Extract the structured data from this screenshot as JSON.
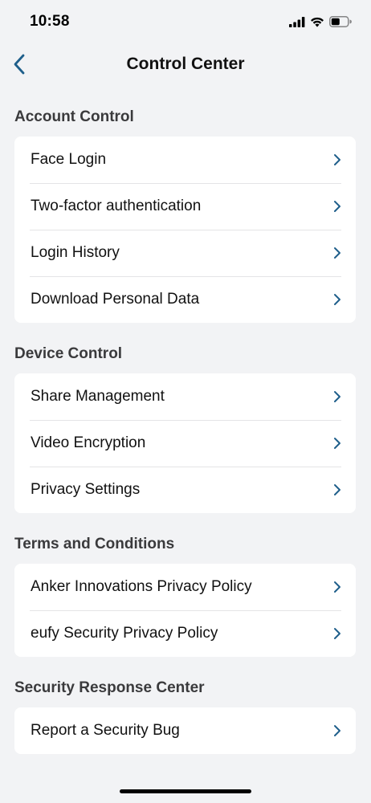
{
  "status_bar": {
    "time": "10:58"
  },
  "nav": {
    "title": "Control Center",
    "back_icon": "chevron-left-icon"
  },
  "colors": {
    "accent": "#1f5f8b",
    "background": "#f2f3f5",
    "card": "#ffffff"
  },
  "sections": [
    {
      "header": "Account Control",
      "items": [
        {
          "label": "Face Login"
        },
        {
          "label": "Two-factor authentication"
        },
        {
          "label": "Login History"
        },
        {
          "label": "Download Personal Data"
        }
      ]
    },
    {
      "header": "Device Control",
      "items": [
        {
          "label": "Share Management"
        },
        {
          "label": "Video Encryption"
        },
        {
          "label": "Privacy Settings"
        }
      ]
    },
    {
      "header": "Terms and Conditions",
      "items": [
        {
          "label": "Anker Innovations Privacy Policy"
        },
        {
          "label": "eufy Security Privacy Policy"
        }
      ]
    },
    {
      "header": "Security Response Center",
      "items": [
        {
          "label": "Report a Security Bug"
        }
      ]
    }
  ]
}
